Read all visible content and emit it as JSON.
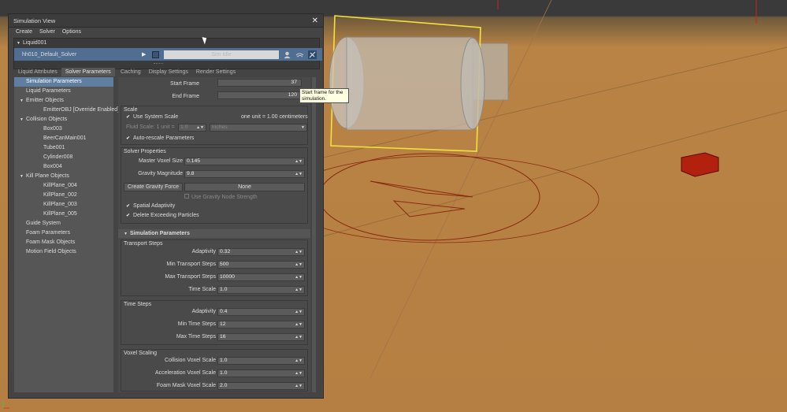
{
  "window": {
    "title": "Simulation View",
    "close": "✕"
  },
  "menu": [
    "Create",
    "Solver",
    "Options"
  ],
  "liquid": {
    "name": "Liquid001",
    "solver_name": "hh010_Default_Solver",
    "progress_label": "Sim Idle",
    "progress_value": 0
  },
  "left_tabs": [
    "Liquid Attributes",
    "Solver Parameters"
  ],
  "right_tabs": [
    "Caching",
    "Display Settings",
    "Render Settings"
  ],
  "tree": [
    {
      "label": "Simulation Parameters",
      "indent": 0,
      "selected": true,
      "expander": ""
    },
    {
      "label": "Liquid Parameters",
      "indent": 0,
      "selected": false,
      "expander": ""
    },
    {
      "label": "Emitter Objects",
      "indent": 0,
      "selected": false,
      "expander": "▼"
    },
    {
      "label": "EmitterOBJ [Override Enabled]",
      "indent": 1,
      "selected": false,
      "expander": ""
    },
    {
      "label": "Collision Objects",
      "indent": 0,
      "selected": false,
      "expander": "▼"
    },
    {
      "label": "Box003",
      "indent": 1,
      "selected": false,
      "expander": ""
    },
    {
      "label": "BeerCanMain001",
      "indent": 1,
      "selected": false,
      "expander": ""
    },
    {
      "label": "Tube001",
      "indent": 1,
      "selected": false,
      "expander": ""
    },
    {
      "label": "Cylinder008",
      "indent": 1,
      "selected": false,
      "expander": ""
    },
    {
      "label": "Box004",
      "indent": 1,
      "selected": false,
      "expander": ""
    },
    {
      "label": "Kill Plane Objects",
      "indent": 0,
      "selected": false,
      "expander": "▼"
    },
    {
      "label": "KillPlane_004",
      "indent": 1,
      "selected": false,
      "expander": ""
    },
    {
      "label": "KillPlane_002",
      "indent": 1,
      "selected": false,
      "expander": ""
    },
    {
      "label": "KillPlane_003",
      "indent": 1,
      "selected": false,
      "expander": ""
    },
    {
      "label": "KillPlane_005",
      "indent": 1,
      "selected": false,
      "expander": ""
    },
    {
      "label": "Guide System",
      "indent": 0,
      "selected": false,
      "expander": ""
    },
    {
      "label": "Foam Parameters",
      "indent": 0,
      "selected": false,
      "expander": ""
    },
    {
      "label": "Foam Mask Objects",
      "indent": 0,
      "selected": false,
      "expander": ""
    },
    {
      "label": "Motion Field Objects",
      "indent": 0,
      "selected": false,
      "expander": ""
    }
  ],
  "frames": {
    "start_label": "Start Frame",
    "start_value": "37",
    "end_label": "End Frame",
    "end_value": "120"
  },
  "tooltip": "Start frame for the simulation.",
  "scale": {
    "header": "Scale",
    "use_system_scale": "Use System Scale",
    "unit_info": "one unit = 1.00 centimeters",
    "fluid_scale_label": "Fluid Scale: 1 unit =",
    "fluid_scale_value": "1.0",
    "fluid_scale_units": "inches",
    "auto_rescale": "Auto-rescale Parameters"
  },
  "solver_properties": {
    "header": "Solver Properties",
    "voxel_label": "Master Voxel Size",
    "voxel_value": "0.145",
    "gravity_label": "Gravity Magnitude",
    "gravity_value": "9.8",
    "create_gravity": "Create Gravity Force",
    "gravity_none": "None",
    "use_gravity_strength": "Use Gravity Node Strength",
    "spatial_adaptivity": "Spatial Adaptivity",
    "delete_exceeding": "Delete Exceeding Particles"
  },
  "simulation_parameters": {
    "section": "Simulation Parameters",
    "transport_header": "Transport Steps",
    "transport": [
      {
        "label": "Adaptivity",
        "value": "0.32"
      },
      {
        "label": "Min Transport Steps",
        "value": "500"
      },
      {
        "label": "Max Transport Steps",
        "value": "10000"
      },
      {
        "label": "Time Scale",
        "value": "1.0"
      }
    ],
    "time_header": "Time Steps",
    "time": [
      {
        "label": "Adaptivity",
        "value": "0.4"
      },
      {
        "label": "Min Time Steps",
        "value": "12"
      },
      {
        "label": "Max Time Steps",
        "value": "16"
      }
    ],
    "voxel_header": "Voxel Scaling",
    "voxel": [
      {
        "label": "Collision Voxel Scale",
        "value": "1.0"
      },
      {
        "label": "Acceleration Voxel Scale",
        "value": "1.0"
      },
      {
        "label": "Foam Mask Voxel Scale",
        "value": "2.0"
      }
    ]
  },
  "colors": {
    "viewport": "#b57f43",
    "selection": "#f2e23a",
    "accent": "#5f7ea0"
  }
}
